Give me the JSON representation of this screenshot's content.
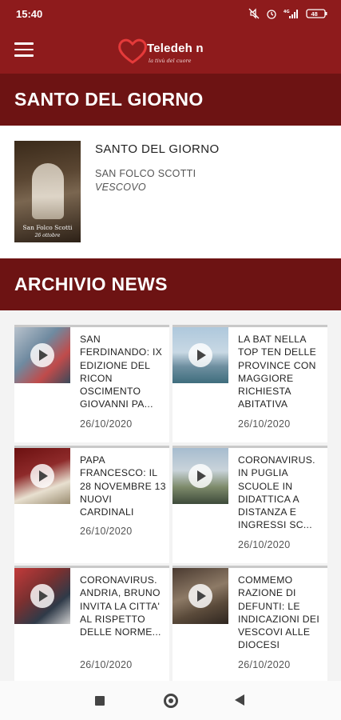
{
  "status_bar": {
    "time": "15:40",
    "battery": "48",
    "icons": [
      "mute-icon",
      "alarm-icon",
      "signal-4g-icon",
      "battery-icon"
    ]
  },
  "app_bar": {
    "logo_text": "Teledeh n",
    "logo_sub": "la tivù del cuore",
    "menu_icon": "hamburger-menu-icon"
  },
  "saint_section": {
    "header": "SANTO DEL GIORNO",
    "card_title": "SANTO DEL GIORNO",
    "name": "SAN FOLCO SCOTTI",
    "role": "VESCOVO",
    "image_caption": "San Folco Scotti",
    "image_date": "26 ottobre"
  },
  "news_section": {
    "header": "ARCHIVIO NEWS",
    "items": [
      {
        "title": "SAN FERDINANDO: IX EDIZIONE DEL RICON OSCIMENTO GIOVANNI PA...",
        "date": "26/10/2020"
      },
      {
        "title": "LA BAT NELLA TOP TEN DELLE PROVINCE CON MAGGIORE RICHIESTA ABITATIVA",
        "date": "26/10/2020"
      },
      {
        "title": "PAPA FRANCESCO: IL 28 NOVEMBRE 13 NUOVI CARDINALI",
        "date": "26/10/2020"
      },
      {
        "title": "CORONAVIRUS. IN PUGLIA SCUOLE IN DIDATTICA A DISTANZA E INGRESSI SC...",
        "date": "26/10/2020"
      },
      {
        "title": "CORONAVIRUS. ANDRIA, BRUNO INVITA LA CITTA' AL RISPETTO DELLE NORME...",
        "date": "26/10/2020"
      },
      {
        "title": "COMMEMO RAZIONE DI DEFUNTI: LE INDICAZIONI DEI VESCOVI ALLE DIOCESI",
        "date": "26/10/2020"
      }
    ]
  },
  "nav_bar": {
    "icons": [
      "recent-apps-icon",
      "home-icon",
      "back-icon"
    ]
  },
  "colors": {
    "brand_red": "#8e1b1c",
    "header_red": "#6d1313"
  }
}
